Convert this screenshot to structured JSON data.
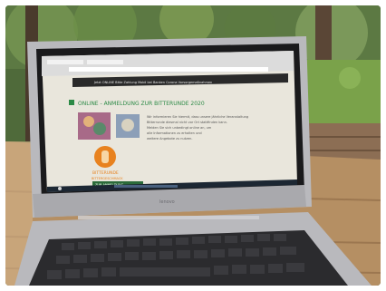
{
  "photo": {
    "subject": "laptop-on-wooden-table-outdoors",
    "colors": {
      "foliage_dark": "#2f4a28",
      "foliage_light": "#7a9a54",
      "lawn": "#7aa24a",
      "table_wood": "#b58f63",
      "table_wood_light": "#d6b48a",
      "laptop_silver": "#b9b9bd",
      "keyboard": "#2b2b2e",
      "screen_bg": "#e9e6dc"
    }
  },
  "laptop": {
    "brand": "lenovo"
  },
  "screen": {
    "banner_text": "Jetzt ONLINE Bitte Zahlung Mobil bei Banken Corona Vorsorgemaßnahmen",
    "heading": "ONLINE - ANMELDUNG ZUR BITTERUNDE 2020",
    "body_lines": [
      "Wir informieren Sie hiermit, dass unsere jährliche Veranstaltung",
      "Bitterrunde diesmal nicht vor Ort stattfinden kann.",
      "Melden Sie sich unbedingt online an, um",
      "alle Informationen zu erhalten und",
      "weitere Angebote zu nutzen."
    ],
    "logo_text": "BITTERUNDE",
    "logo_subtext": "BITTERGESCHMACK",
    "form_label": "ZUR ANMELDUNG",
    "colors": {
      "banner_bg": "#2a2a2a",
      "heading_green": "#2c8a46",
      "logo_orange": "#e8821f",
      "form_green": "#2b6b3a",
      "taskbar": "#1c2733"
    }
  }
}
